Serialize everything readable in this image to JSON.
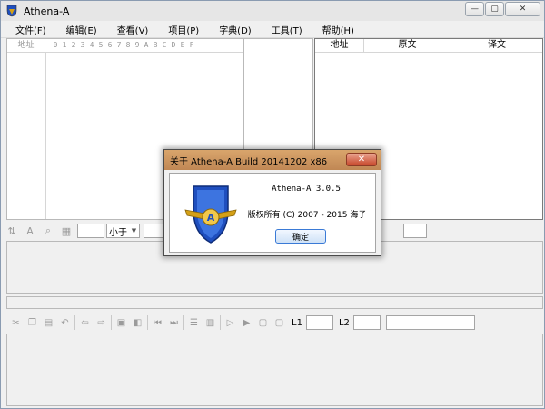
{
  "window": {
    "title": "Athena-A",
    "buttons": {
      "minimize": "—",
      "maximize": "▢",
      "close": "✕"
    }
  },
  "menu": [
    {
      "label": "文件(F)"
    },
    {
      "label": "编辑(E)"
    },
    {
      "label": "查看(V)"
    },
    {
      "label": "项目(P)"
    },
    {
      "label": "字典(D)"
    },
    {
      "label": "工具(T)"
    },
    {
      "label": "帮助(H)"
    }
  ],
  "hex_view": {
    "address_header": "地址",
    "digits": [
      "0",
      "1",
      "2",
      "3",
      "4",
      "5",
      "6",
      "7",
      "8",
      "9",
      "A",
      "B",
      "C",
      "D",
      "E",
      "F"
    ]
  },
  "string_table": {
    "columns": [
      "地址",
      "原文",
      "译文"
    ]
  },
  "toolbar1": {
    "compare_select_value": "小于"
  },
  "toolbar2": {
    "l1_label": "L1",
    "l2_label": "L2"
  },
  "dialog": {
    "title": "关于 Athena-A Build 20141202 x86",
    "close_glyph": "✕",
    "version": "Athena-A 3.0.5",
    "copyright": "版权所有 (C) 2007 - 2015 海子",
    "ok_label": "确定"
  },
  "colors": {
    "titlebar": "#e6e6e6",
    "dialog_titlebar": "#c9925e",
    "dialog_close": "#c7472a",
    "shield_blue": "#1f4fbf",
    "wing_gold": "#d4a017"
  },
  "icons": {
    "app": "athena-shield-icon",
    "logo": "athena-shield-logo"
  }
}
